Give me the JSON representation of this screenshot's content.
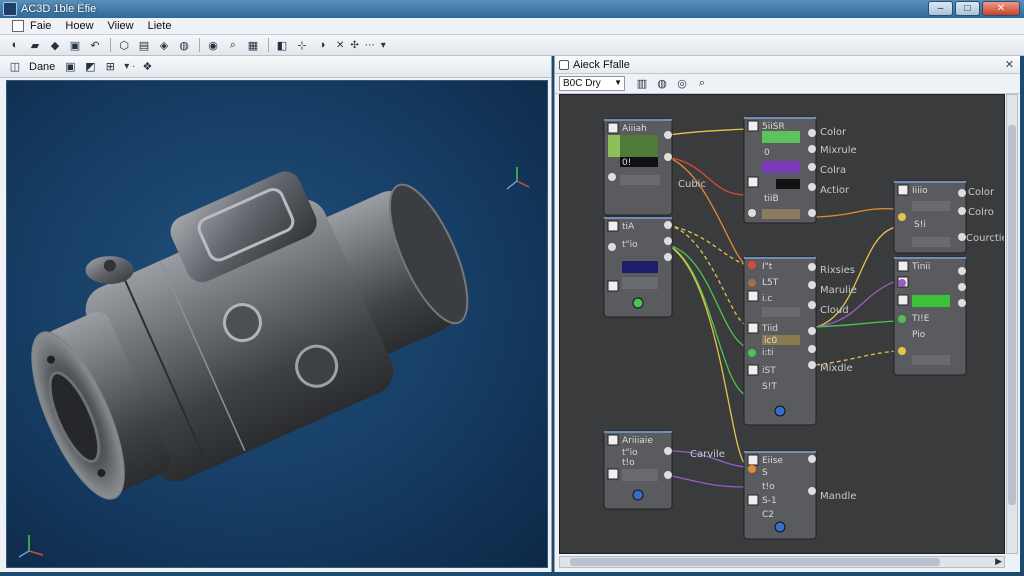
{
  "window": {
    "title": "AC3D 1ble Ëfie",
    "controls": [
      "–",
      "□",
      "✕"
    ]
  },
  "menu": [
    "Faie",
    "Hoew",
    "Viiew",
    "Liete"
  ],
  "left_toolbar": {
    "label": "Dane"
  },
  "right_panel": {
    "title": "Aieck Ffalle",
    "dropdown": "B0C Dry"
  },
  "nodes": {
    "n1": {
      "title": "Aiiiah",
      "rows": [
        "0!",
        ""
      ]
    },
    "n2": {
      "title": "tiA",
      "rows": [
        "t\"io",
        ""
      ]
    },
    "n3": {
      "title": "Ariiiaie",
      "rows": [
        "t\"io",
        "t!o"
      ]
    },
    "n4": {
      "title": "5iiSR",
      "rows": [
        "0",
        "tiiB"
      ]
    },
    "n5": {
      "title": "I\"t",
      "rows": [
        "L5T",
        "i.c",
        "Tiid",
        "ic0",
        "i:ti",
        "iST",
        "S!T"
      ]
    },
    "n6": {
      "title": "Eiise",
      "rows": [
        "S",
        "t!o",
        "S-1",
        "C2"
      ]
    },
    "n7": {
      "title": "Iiiio",
      "rows": [
        "",
        "S!i"
      ]
    },
    "n8": {
      "title": "Tinii",
      "rows": [
        "TI!E",
        "Pio"
      ]
    }
  },
  "side_labels": {
    "cubic": "Cubic",
    "color_a": "Color",
    "mixrule": "Mixrule",
    "colra": "Colra",
    "actior": "Actior",
    "rixsies": "Rixsies",
    "marulie": "Marulie",
    "cloud": "Cloud",
    "mixdle": "Mixdle",
    "color_b": "Color",
    "colro": "Colro",
    "courctie": "Courctie",
    "carvile": "Carvile",
    "mandle": "Mandle"
  },
  "colors": {
    "viewport_bg": "#163c63",
    "graph_bg": "#3a3b3d",
    "node_bg": "#5a5b5e",
    "wire_yellow": "#e6c34a",
    "wire_green": "#4fc24f",
    "wire_red": "#d94a3a",
    "wire_purple": "#9b5cc8",
    "wire_orange": "#e08a3a"
  }
}
